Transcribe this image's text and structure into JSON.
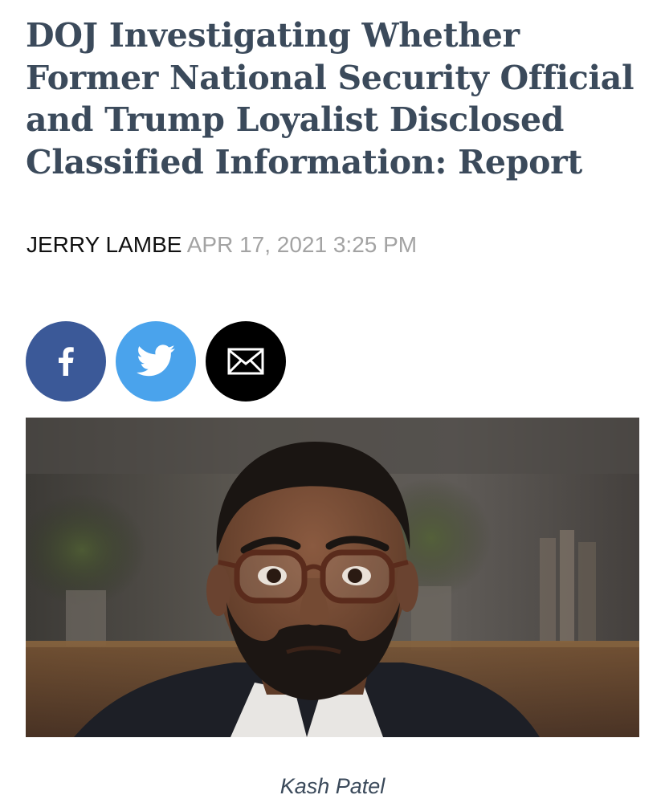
{
  "article": {
    "headline": "DOJ Investigating Whether Former National Security Official and Trump Loyalist Disclosed Classified Information: Report",
    "author": "JERRY LAMBE",
    "date": "APR 17, 2021 3:25 PM"
  },
  "share": [
    {
      "network": "facebook",
      "icon": "facebook-icon",
      "color": "#3b5998"
    },
    {
      "network": "twitter",
      "icon": "twitter-icon",
      "color": "#4aa3ec"
    },
    {
      "network": "email",
      "icon": "envelope-icon",
      "color": "#000000"
    }
  ],
  "photo": {
    "caption": "Kash Patel"
  },
  "colors": {
    "headline": "#3b4a5b",
    "date": "#a3a3a3"
  }
}
